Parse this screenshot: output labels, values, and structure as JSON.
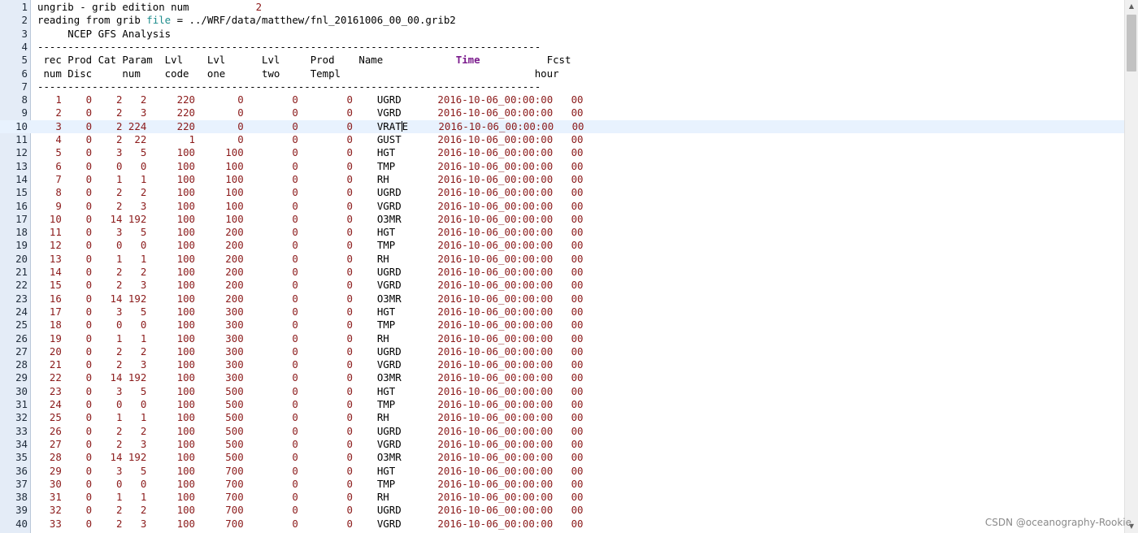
{
  "editor": {
    "header_lines": [
      {
        "text": "ungrib - grib edition num           "
      },
      {
        "text": "reading from grib "
      },
      {
        "text": "     NCEP GFS Analysis"
      },
      {
        "text": "-----------------------------------------------------------------------------------"
      },
      {
        "text": " rec Prod Cat Param  Lvl    Lvl      Lvl     Prod    Name            "
      },
      {
        "text": " num Disc     num    code   one      two     Templ                                hour"
      },
      {
        "text": "-----------------------------------------------------------------------------------"
      }
    ],
    "edition_num": "2",
    "file_keyword": "file",
    "file_path": " = ../WRF/data/matthew/fnl_20161006_00_00.grib2",
    "time_header": "Time",
    "fcst_header": "Fcst",
    "header_tail": "           ",
    "current_line": 10,
    "rows": [
      {
        "rec": "1",
        "disc": "0",
        "cat": "2",
        "param": "2",
        "code": "220",
        "one": "0",
        "two": "0",
        "templ": "0",
        "name": "UGRD",
        "time": "2016-10-06_00:00:00",
        "hour": "00"
      },
      {
        "rec": "2",
        "disc": "0",
        "cat": "2",
        "param": "3",
        "code": "220",
        "one": "0",
        "two": "0",
        "templ": "0",
        "name": "VGRD",
        "time": "2016-10-06_00:00:00",
        "hour": "00"
      },
      {
        "rec": "3",
        "disc": "0",
        "cat": "2",
        "param": "224",
        "code": "220",
        "one": "0",
        "two": "0",
        "templ": "0",
        "name": "VRATE",
        "time": "2016-10-06_00:00:00",
        "hour": "00"
      },
      {
        "rec": "4",
        "disc": "0",
        "cat": "2",
        "param": "22",
        "code": "1",
        "one": "0",
        "two": "0",
        "templ": "0",
        "name": "GUST",
        "time": "2016-10-06_00:00:00",
        "hour": "00"
      },
      {
        "rec": "5",
        "disc": "0",
        "cat": "3",
        "param": "5",
        "code": "100",
        "one": "100",
        "two": "0",
        "templ": "0",
        "name": "HGT",
        "time": "2016-10-06_00:00:00",
        "hour": "00"
      },
      {
        "rec": "6",
        "disc": "0",
        "cat": "0",
        "param": "0",
        "code": "100",
        "one": "100",
        "two": "0",
        "templ": "0",
        "name": "TMP",
        "time": "2016-10-06_00:00:00",
        "hour": "00"
      },
      {
        "rec": "7",
        "disc": "0",
        "cat": "1",
        "param": "1",
        "code": "100",
        "one": "100",
        "two": "0",
        "templ": "0",
        "name": "RH",
        "time": "2016-10-06_00:00:00",
        "hour": "00"
      },
      {
        "rec": "8",
        "disc": "0",
        "cat": "2",
        "param": "2",
        "code": "100",
        "one": "100",
        "two": "0",
        "templ": "0",
        "name": "UGRD",
        "time": "2016-10-06_00:00:00",
        "hour": "00"
      },
      {
        "rec": "9",
        "disc": "0",
        "cat": "2",
        "param": "3",
        "code": "100",
        "one": "100",
        "two": "0",
        "templ": "0",
        "name": "VGRD",
        "time": "2016-10-06_00:00:00",
        "hour": "00"
      },
      {
        "rec": "10",
        "disc": "0",
        "cat": "14",
        "param": "192",
        "code": "100",
        "one": "100",
        "two": "0",
        "templ": "0",
        "name": "O3MR",
        "time": "2016-10-06_00:00:00",
        "hour": "00"
      },
      {
        "rec": "11",
        "disc": "0",
        "cat": "3",
        "param": "5",
        "code": "100",
        "one": "200",
        "two": "0",
        "templ": "0",
        "name": "HGT",
        "time": "2016-10-06_00:00:00",
        "hour": "00"
      },
      {
        "rec": "12",
        "disc": "0",
        "cat": "0",
        "param": "0",
        "code": "100",
        "one": "200",
        "two": "0",
        "templ": "0",
        "name": "TMP",
        "time": "2016-10-06_00:00:00",
        "hour": "00"
      },
      {
        "rec": "13",
        "disc": "0",
        "cat": "1",
        "param": "1",
        "code": "100",
        "one": "200",
        "two": "0",
        "templ": "0",
        "name": "RH",
        "time": "2016-10-06_00:00:00",
        "hour": "00"
      },
      {
        "rec": "14",
        "disc": "0",
        "cat": "2",
        "param": "2",
        "code": "100",
        "one": "200",
        "two": "0",
        "templ": "0",
        "name": "UGRD",
        "time": "2016-10-06_00:00:00",
        "hour": "00"
      },
      {
        "rec": "15",
        "disc": "0",
        "cat": "2",
        "param": "3",
        "code": "100",
        "one": "200",
        "two": "0",
        "templ": "0",
        "name": "VGRD",
        "time": "2016-10-06_00:00:00",
        "hour": "00"
      },
      {
        "rec": "16",
        "disc": "0",
        "cat": "14",
        "param": "192",
        "code": "100",
        "one": "200",
        "two": "0",
        "templ": "0",
        "name": "O3MR",
        "time": "2016-10-06_00:00:00",
        "hour": "00"
      },
      {
        "rec": "17",
        "disc": "0",
        "cat": "3",
        "param": "5",
        "code": "100",
        "one": "300",
        "two": "0",
        "templ": "0",
        "name": "HGT",
        "time": "2016-10-06_00:00:00",
        "hour": "00"
      },
      {
        "rec": "18",
        "disc": "0",
        "cat": "0",
        "param": "0",
        "code": "100",
        "one": "300",
        "two": "0",
        "templ": "0",
        "name": "TMP",
        "time": "2016-10-06_00:00:00",
        "hour": "00"
      },
      {
        "rec": "19",
        "disc": "0",
        "cat": "1",
        "param": "1",
        "code": "100",
        "one": "300",
        "two": "0",
        "templ": "0",
        "name": "RH",
        "time": "2016-10-06_00:00:00",
        "hour": "00"
      },
      {
        "rec": "20",
        "disc": "0",
        "cat": "2",
        "param": "2",
        "code": "100",
        "one": "300",
        "two": "0",
        "templ": "0",
        "name": "UGRD",
        "time": "2016-10-06_00:00:00",
        "hour": "00"
      },
      {
        "rec": "21",
        "disc": "0",
        "cat": "2",
        "param": "3",
        "code": "100",
        "one": "300",
        "two": "0",
        "templ": "0",
        "name": "VGRD",
        "time": "2016-10-06_00:00:00",
        "hour": "00"
      },
      {
        "rec": "22",
        "disc": "0",
        "cat": "14",
        "param": "192",
        "code": "100",
        "one": "300",
        "two": "0",
        "templ": "0",
        "name": "O3MR",
        "time": "2016-10-06_00:00:00",
        "hour": "00"
      },
      {
        "rec": "23",
        "disc": "0",
        "cat": "3",
        "param": "5",
        "code": "100",
        "one": "500",
        "two": "0",
        "templ": "0",
        "name": "HGT",
        "time": "2016-10-06_00:00:00",
        "hour": "00"
      },
      {
        "rec": "24",
        "disc": "0",
        "cat": "0",
        "param": "0",
        "code": "100",
        "one": "500",
        "two": "0",
        "templ": "0",
        "name": "TMP",
        "time": "2016-10-06_00:00:00",
        "hour": "00"
      },
      {
        "rec": "25",
        "disc": "0",
        "cat": "1",
        "param": "1",
        "code": "100",
        "one": "500",
        "two": "0",
        "templ": "0",
        "name": "RH",
        "time": "2016-10-06_00:00:00",
        "hour": "00"
      },
      {
        "rec": "26",
        "disc": "0",
        "cat": "2",
        "param": "2",
        "code": "100",
        "one": "500",
        "two": "0",
        "templ": "0",
        "name": "UGRD",
        "time": "2016-10-06_00:00:00",
        "hour": "00"
      },
      {
        "rec": "27",
        "disc": "0",
        "cat": "2",
        "param": "3",
        "code": "100",
        "one": "500",
        "two": "0",
        "templ": "0",
        "name": "VGRD",
        "time": "2016-10-06_00:00:00",
        "hour": "00"
      },
      {
        "rec": "28",
        "disc": "0",
        "cat": "14",
        "param": "192",
        "code": "100",
        "one": "500",
        "two": "0",
        "templ": "0",
        "name": "O3MR",
        "time": "2016-10-06_00:00:00",
        "hour": "00"
      },
      {
        "rec": "29",
        "disc": "0",
        "cat": "3",
        "param": "5",
        "code": "100",
        "one": "700",
        "two": "0",
        "templ": "0",
        "name": "HGT",
        "time": "2016-10-06_00:00:00",
        "hour": "00"
      },
      {
        "rec": "30",
        "disc": "0",
        "cat": "0",
        "param": "0",
        "code": "100",
        "one": "700",
        "two": "0",
        "templ": "0",
        "name": "TMP",
        "time": "2016-10-06_00:00:00",
        "hour": "00"
      },
      {
        "rec": "31",
        "disc": "0",
        "cat": "1",
        "param": "1",
        "code": "100",
        "one": "700",
        "two": "0",
        "templ": "0",
        "name": "RH",
        "time": "2016-10-06_00:00:00",
        "hour": "00"
      },
      {
        "rec": "32",
        "disc": "0",
        "cat": "2",
        "param": "2",
        "code": "100",
        "one": "700",
        "two": "0",
        "templ": "0",
        "name": "UGRD",
        "time": "2016-10-06_00:00:00",
        "hour": "00"
      },
      {
        "rec": "33",
        "disc": "0",
        "cat": "2",
        "param": "3",
        "code": "100",
        "one": "700",
        "two": "0",
        "templ": "0",
        "name": "VGRD",
        "time": "2016-10-06_00:00:00",
        "hour": "00"
      }
    ]
  },
  "scrollbar": {
    "up_icon": "triangle-up-icon",
    "down_icon": "triangle-down-icon"
  },
  "watermark": "CSDN @oceanography-Rookie",
  "colors": {
    "number": "#8b1a1a",
    "keyword": "#1c8c8c",
    "time_header": "#7a1a8c",
    "gutter": "#e4ecf7",
    "current_line": "#e8f2fe"
  }
}
